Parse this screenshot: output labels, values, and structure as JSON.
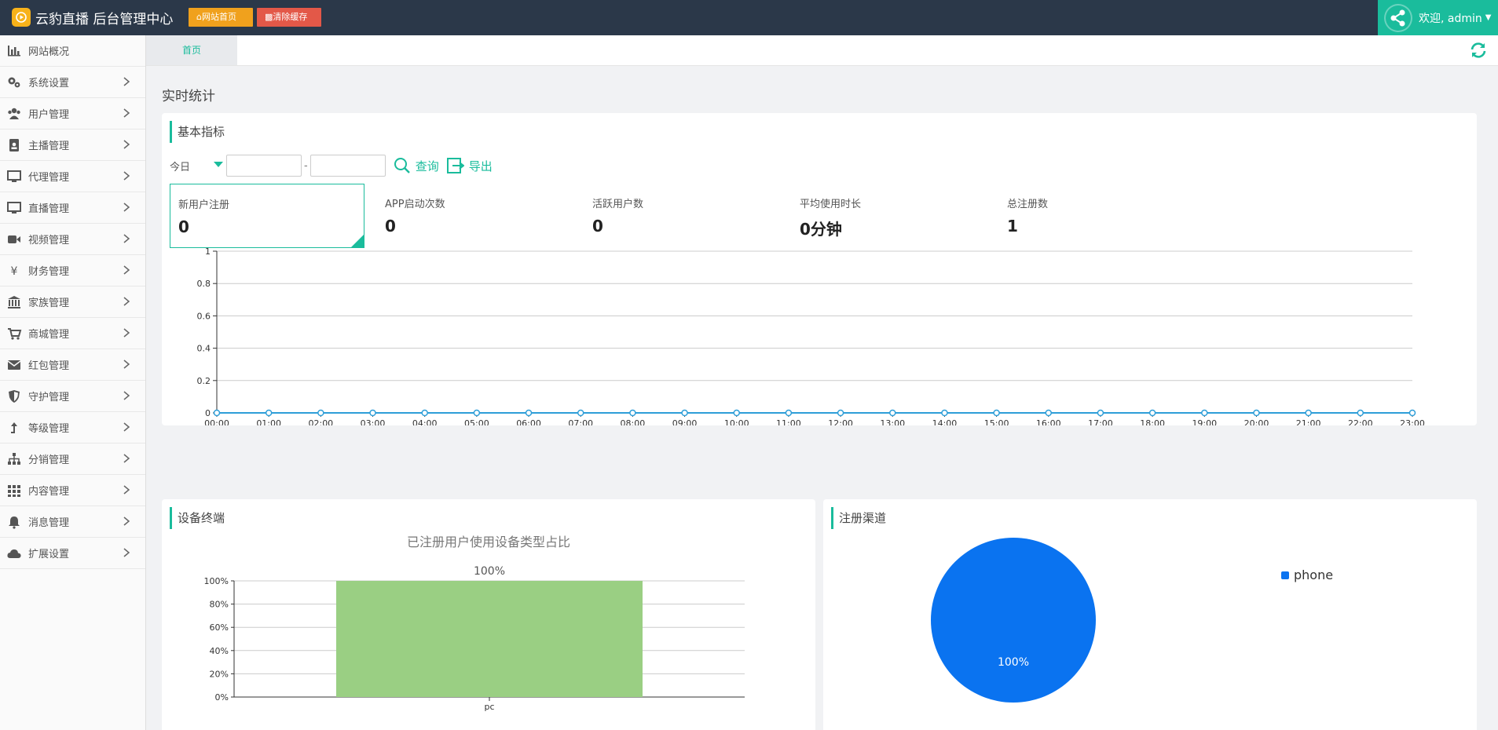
{
  "header": {
    "brand_icon": "play-icon",
    "brand_title": "云豹直播 后台管理中心",
    "home_button": "网站首页",
    "clear_cache_button": "清除缓存",
    "welcome": "欢迎, admin",
    "colors": {
      "bar": "#2b3849",
      "accent": "#1abc9c",
      "home": "#f0a11d",
      "clear": "#e35848"
    }
  },
  "sidebar": {
    "items": [
      {
        "label": "网站概况",
        "icon": "bar-chart-icon"
      },
      {
        "label": "系统设置",
        "icon": "gears-icon"
      },
      {
        "label": "用户管理",
        "icon": "users-icon"
      },
      {
        "label": "主播管理",
        "icon": "id-badge-icon"
      },
      {
        "label": "代理管理",
        "icon": "monitor-icon"
      },
      {
        "label": "直播管理",
        "icon": "desktop-icon"
      },
      {
        "label": "视频管理",
        "icon": "video-camera-icon"
      },
      {
        "label": "财务管理",
        "icon": "yen-icon"
      },
      {
        "label": "家族管理",
        "icon": "bank-icon"
      },
      {
        "label": "商城管理",
        "icon": "cart-icon"
      },
      {
        "label": "红包管理",
        "icon": "envelope-icon"
      },
      {
        "label": "守护管理",
        "icon": "shield-icon"
      },
      {
        "label": "等级管理",
        "icon": "level-up-icon"
      },
      {
        "label": "分销管理",
        "icon": "sitemap-icon"
      },
      {
        "label": "内容管理",
        "icon": "grid-icon"
      },
      {
        "label": "消息管理",
        "icon": "bell-icon"
      },
      {
        "label": "扩展设置",
        "icon": "cloud-icon"
      }
    ]
  },
  "tabs": {
    "home": "首页"
  },
  "main": {
    "section_title": "实时统计",
    "basic": {
      "title": "基本指标",
      "period": "今日",
      "date_sep": "-",
      "query": "查询",
      "export": "导出",
      "stats": [
        {
          "label": "新用户注册",
          "value": "0"
        },
        {
          "label": "APP启动次数",
          "value": "0"
        },
        {
          "label": "活跃用户数",
          "value": "0"
        },
        {
          "label": "平均使用时长",
          "value": "0分钟"
        },
        {
          "label": "总注册数",
          "value": "1"
        }
      ]
    },
    "device": {
      "title": "设备终端"
    },
    "channel": {
      "title": "注册渠道"
    }
  },
  "chart_data": [
    {
      "type": "line",
      "title": "",
      "x": [
        "00:00",
        "01:00",
        "02:00",
        "03:00",
        "04:00",
        "05:00",
        "06:00",
        "07:00",
        "08:00",
        "09:00",
        "10:00",
        "11:00",
        "12:00",
        "13:00",
        "14:00",
        "15:00",
        "16:00",
        "17:00",
        "18:00",
        "19:00",
        "20:00",
        "21:00",
        "22:00",
        "23:00"
      ],
      "series": [
        {
          "values": [
            0,
            0,
            0,
            0,
            0,
            0,
            0,
            0,
            0,
            0,
            0,
            0,
            0,
            0,
            0,
            0,
            0,
            0,
            0,
            0,
            0,
            0,
            0,
            0
          ]
        }
      ],
      "yticks": [
        "0",
        "0.2",
        "0.4",
        "0.6",
        "0.8",
        "1"
      ],
      "ylim": [
        0,
        1
      ],
      "grid": true,
      "color": "#2e9ed8"
    },
    {
      "type": "bar",
      "title": "已注册用户使用设备类型占比",
      "categories": [
        "pc"
      ],
      "values": [
        100
      ],
      "data_labels": [
        "100%"
      ],
      "yticks": [
        "0%",
        "20%",
        "40%",
        "60%",
        "80%",
        "100%"
      ],
      "ylim": [
        0,
        100
      ],
      "grid": true,
      "color": "#9acf83"
    },
    {
      "type": "pie",
      "slices": [
        {
          "name": "phone",
          "value": 100,
          "label": "100%"
        }
      ],
      "legend": "top-right",
      "color": "#0a73f0"
    }
  ]
}
